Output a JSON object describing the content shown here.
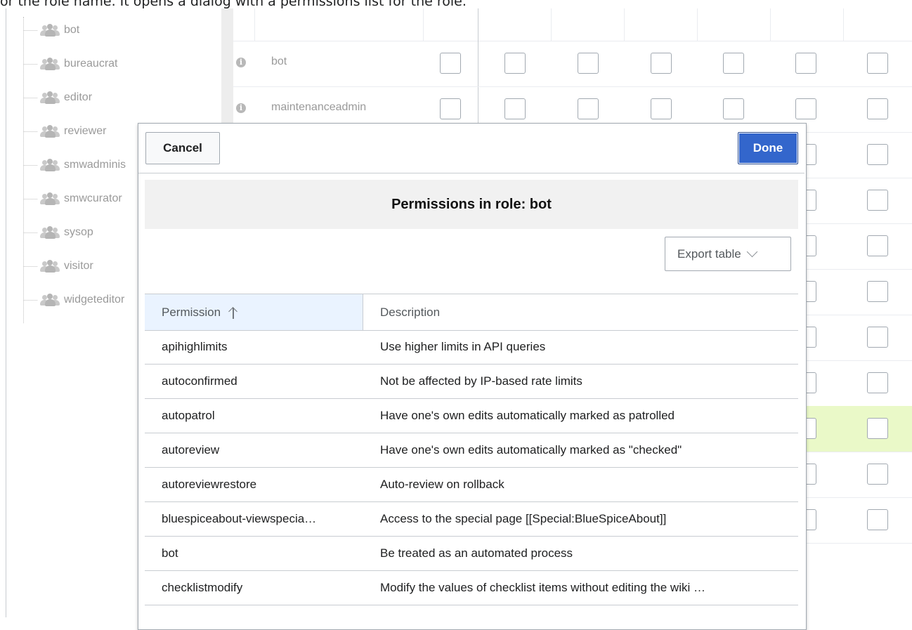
{
  "caption": "or the role name. It opens a dialog with a permissions list for the role.",
  "tree": {
    "items": [
      "bot",
      "bureaucrat",
      "editor",
      "reviewer",
      "smwadminis",
      "smwcurator",
      "sysop",
      "visitor",
      "widgeteditor"
    ]
  },
  "grid": {
    "rows": [
      "bot",
      "maintenanceadmin"
    ]
  },
  "dialog": {
    "cancel_label": "Cancel",
    "done_label": "Done",
    "title": "Permissions in role: bot",
    "export_label": "Export table",
    "columns": {
      "permission": "Permission",
      "description": "Description"
    },
    "rows": [
      {
        "permission": "apihighlimits",
        "description": "Use higher limits in API queries"
      },
      {
        "permission": "autoconfirmed",
        "description": "Not be affected by IP-based rate limits"
      },
      {
        "permission": "autopatrol",
        "description": "Have one's own edits automatically marked as patrolled"
      },
      {
        "permission": "autoreview",
        "description": "Have one's own edits automatically marked as \"checked\""
      },
      {
        "permission": "autoreviewrestore",
        "description": "Auto-review on rollback"
      },
      {
        "permission": "bluespiceabout-viewspecia…",
        "description": "Access to the special page [[Special:BlueSpiceAbout]]"
      },
      {
        "permission": "bot",
        "description": "Be treated as an automated process"
      },
      {
        "permission": "checklistmodify",
        "description": "Modify the values of checklist items without editing the wiki …"
      }
    ]
  },
  "colors": {
    "primary": "#3366cc",
    "highlight_row": "#eaf9c8",
    "sorted_header": "#eaf3ff"
  },
  "icons": [
    "group-icon",
    "info-icon",
    "chevron-down-icon",
    "sort-ascending-icon"
  ]
}
